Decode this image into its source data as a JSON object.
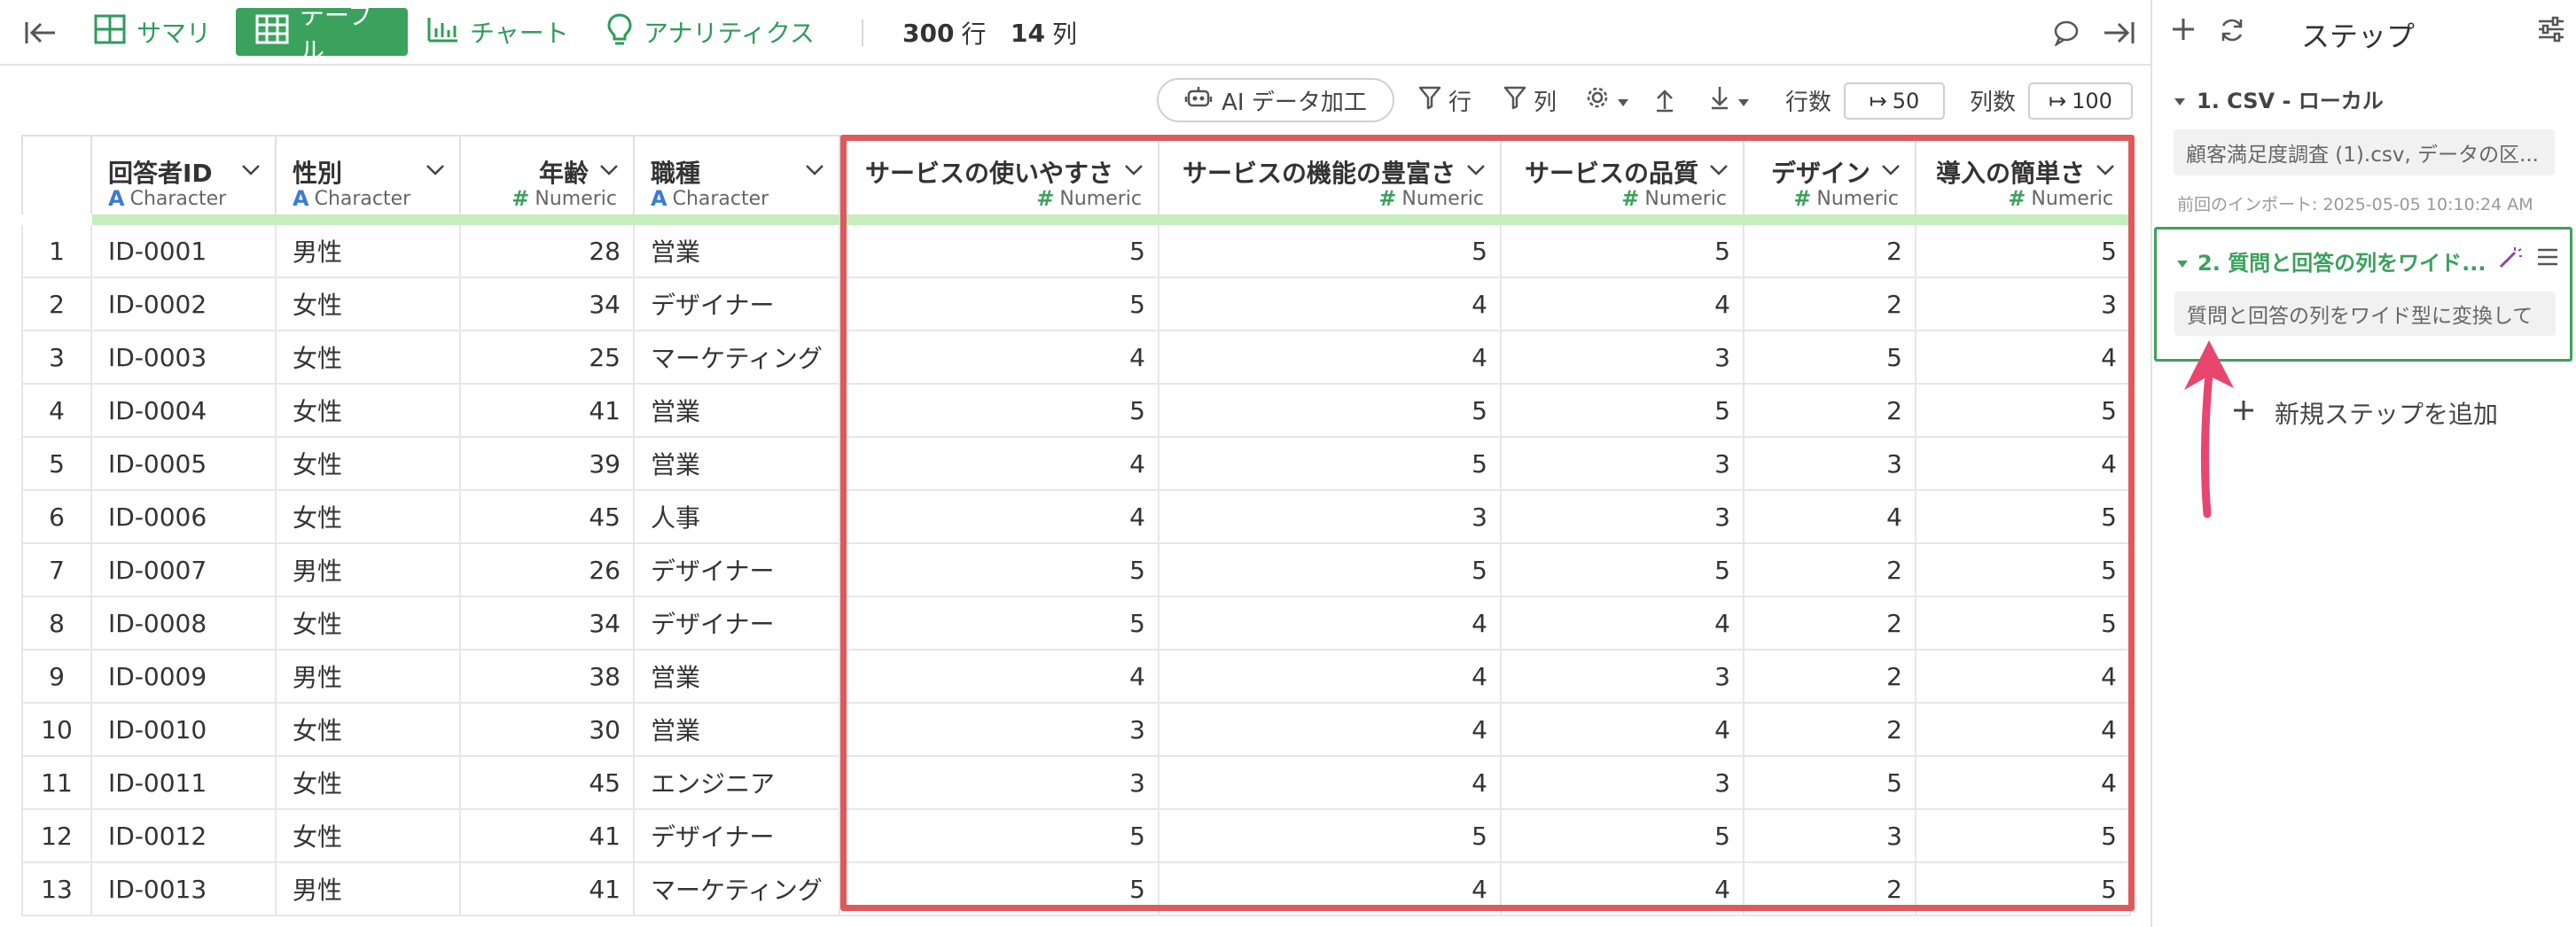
{
  "topbar": {
    "tabs": [
      {
        "label": "サマリ",
        "icon": "summary-grid-icon"
      },
      {
        "label": "テーブル",
        "icon": "table-icon"
      },
      {
        "label": "チャート",
        "icon": "chart-icon"
      },
      {
        "label": "アナリティクス",
        "icon": "lightbulb-icon"
      }
    ],
    "row_count": "300",
    "row_unit": "行",
    "col_count": "14",
    "col_unit": "列"
  },
  "toolbar": {
    "ai_label": "AI データ加工",
    "row_filter_label": "行",
    "col_filter_label": "列",
    "rows_label": "行数",
    "rows_value": "50",
    "cols_label": "列数",
    "cols_value": "100"
  },
  "table": {
    "columns": [
      {
        "name": "回答者ID",
        "type": "Character"
      },
      {
        "name": "性別",
        "type": "Character"
      },
      {
        "name": "年齢",
        "type": "Numeric"
      },
      {
        "name": "職種",
        "type": "Character"
      },
      {
        "name": "サービスの使いやすさ",
        "type": "Numeric"
      },
      {
        "name": "サービスの機能の豊富さ",
        "type": "Numeric"
      },
      {
        "name": "サービスの品質",
        "type": "Numeric"
      },
      {
        "name": "デザイン",
        "type": "Numeric"
      },
      {
        "name": "導入の簡単さ",
        "type": "Numeric"
      }
    ],
    "rows": [
      [
        "1",
        "ID-0001",
        "男性",
        "28",
        "営業",
        "5",
        "5",
        "5",
        "2",
        "5"
      ],
      [
        "2",
        "ID-0002",
        "女性",
        "34",
        "デザイナー",
        "5",
        "4",
        "4",
        "2",
        "3"
      ],
      [
        "3",
        "ID-0003",
        "女性",
        "25",
        "マーケティング",
        "4",
        "4",
        "3",
        "5",
        "4"
      ],
      [
        "4",
        "ID-0004",
        "女性",
        "41",
        "営業",
        "5",
        "5",
        "5",
        "2",
        "5"
      ],
      [
        "5",
        "ID-0005",
        "女性",
        "39",
        "営業",
        "4",
        "5",
        "3",
        "3",
        "4"
      ],
      [
        "6",
        "ID-0006",
        "女性",
        "45",
        "人事",
        "4",
        "3",
        "3",
        "4",
        "5"
      ],
      [
        "7",
        "ID-0007",
        "男性",
        "26",
        "デザイナー",
        "5",
        "5",
        "5",
        "2",
        "5"
      ],
      [
        "8",
        "ID-0008",
        "女性",
        "34",
        "デザイナー",
        "5",
        "4",
        "4",
        "2",
        "5"
      ],
      [
        "9",
        "ID-0009",
        "男性",
        "38",
        "営業",
        "4",
        "4",
        "3",
        "2",
        "4"
      ],
      [
        "10",
        "ID-0010",
        "女性",
        "30",
        "営業",
        "3",
        "4",
        "4",
        "2",
        "4"
      ],
      [
        "11",
        "ID-0011",
        "女性",
        "45",
        "エンジニア",
        "3",
        "4",
        "3",
        "5",
        "4"
      ],
      [
        "12",
        "ID-0012",
        "女性",
        "41",
        "デザイナー",
        "5",
        "5",
        "5",
        "3",
        "5"
      ],
      [
        "13",
        "ID-0013",
        "男性",
        "41",
        "マーケティング",
        "5",
        "4",
        "4",
        "2",
        "5"
      ]
    ]
  },
  "panel": {
    "title": "ステップ",
    "step1": {
      "title": "1. CSV - ローカル",
      "desc": "顧客満足度調査 (1).csv, データの区...",
      "last_import": "前回のインポート: 2025-05-05 10:10:24 AM"
    },
    "step2": {
      "title": "2. 質問と回答の列をワイド...",
      "desc": "質問と回答の列をワイド型に変換して"
    },
    "add_step": "新規ステップを追加"
  },
  "colors": {
    "accent_green": "#3aa25c",
    "highlight_red": "#dd5a5a",
    "arrow_pink": "#e8456f",
    "type_character": "#3a7bd5"
  }
}
